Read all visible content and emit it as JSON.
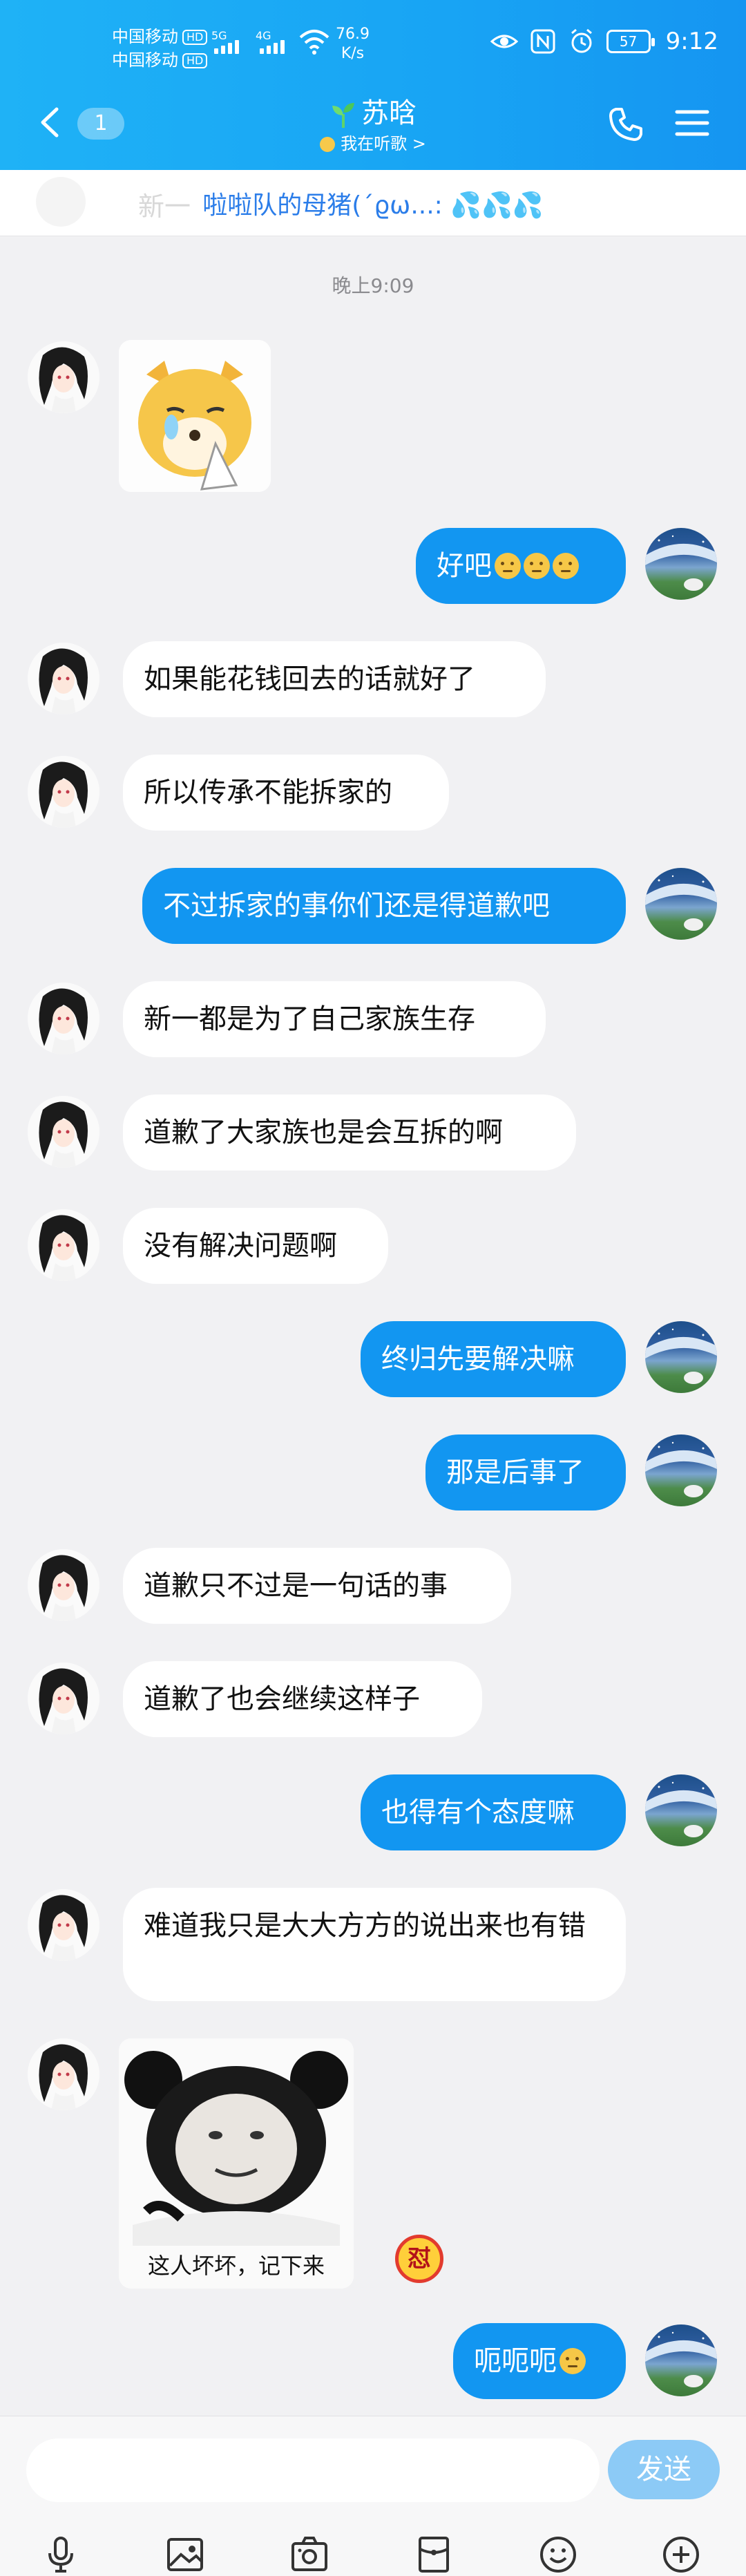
{
  "status_bar": {
    "carrier1": "中国移动",
    "carrier2": "中国移动",
    "hd": "HD",
    "net1": "5G",
    "net2": "4G",
    "speed_value": "76.9",
    "speed_unit": "K/s",
    "battery": "57",
    "time": "9:12"
  },
  "header": {
    "back_count": "1",
    "title": "苏晗",
    "subtitle": "我在听歌 >"
  },
  "notice": {
    "ghost_text": "新一",
    "text": "啦啦队的母猪(´ϱω...: 💦💦💦"
  },
  "timestamp": "晚上9:09",
  "messages": [
    {
      "side": "left",
      "type": "sticker",
      "sticker": "crying-shiba-dog-sticker"
    },
    {
      "side": "right",
      "type": "text",
      "text": "好吧",
      "emojis": 3
    },
    {
      "side": "left",
      "type": "text",
      "text": "如果能花钱回去的话就好了"
    },
    {
      "side": "left",
      "type": "text",
      "text": "所以传承不能拆家的"
    },
    {
      "side": "right",
      "type": "text",
      "text": "不过拆家的事你们还是得道歉吧"
    },
    {
      "side": "left",
      "type": "text",
      "text": "新一都是为了自己家族生存"
    },
    {
      "side": "left",
      "type": "text",
      "text": "道歉了大家族也是会互拆的啊"
    },
    {
      "side": "left",
      "type": "text",
      "text": "没有解决问题啊"
    },
    {
      "side": "right",
      "type": "text",
      "text": "终归先要解决嘛"
    },
    {
      "side": "right",
      "type": "text",
      "text": "那是后事了"
    },
    {
      "side": "left",
      "type": "text",
      "text": "道歉只不过是一句话的事"
    },
    {
      "side": "left",
      "type": "text",
      "text": "道歉了也会继续这样子"
    },
    {
      "side": "right",
      "type": "text",
      "text": "也得有个态度嘛"
    },
    {
      "side": "left",
      "type": "text",
      "text": "难道我只是大大方方的说出来也有错"
    },
    {
      "side": "left",
      "type": "sticker",
      "sticker": "panda-meme-sticker",
      "caption": "这人坏坏，记下来",
      "badge": "怼"
    },
    {
      "side": "right",
      "type": "text",
      "text": "呃呃呃",
      "emojis": 1
    }
  ],
  "input_bar": {
    "placeholder": "",
    "send_label": "发送"
  },
  "toolbar": [
    "microphone-icon",
    "image-icon",
    "camera-icon",
    "red-packet-icon",
    "emoji-icon",
    "plus-icon"
  ],
  "colors": {
    "header": "#1ba8f5",
    "bubble_self": "#1296f1",
    "bubble_other": "#ffffff",
    "notice_text": "#2b7de9",
    "send_button": "#8ccaf6"
  }
}
